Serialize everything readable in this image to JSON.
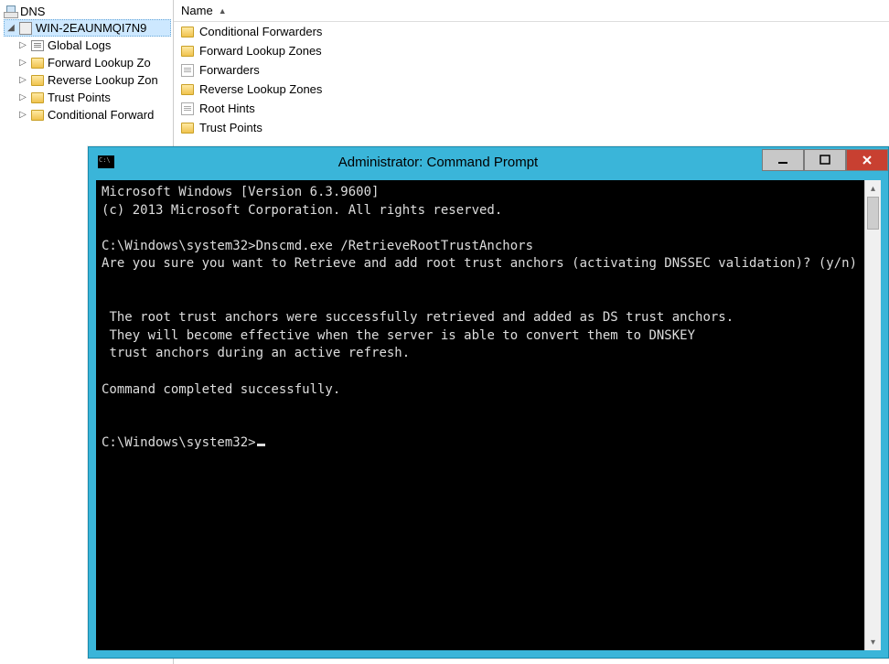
{
  "tree": {
    "root": "DNS",
    "server": "WIN-2EAUNMQI7N9",
    "children": [
      "Global Logs",
      "Forward Lookup Zo",
      "Reverse Lookup Zon",
      "Trust Points",
      "Conditional Forward"
    ]
  },
  "list": {
    "header": "Name",
    "items": [
      {
        "icon": "folder",
        "label": "Conditional Forwarders"
      },
      {
        "icon": "folder",
        "label": "Forward Lookup Zones"
      },
      {
        "icon": "doc",
        "label": "Forwarders"
      },
      {
        "icon": "folder",
        "label": "Reverse Lookup Zones"
      },
      {
        "icon": "doc",
        "label": "Root Hints"
      },
      {
        "icon": "folder",
        "label": "Trust Points"
      }
    ]
  },
  "cmd": {
    "title": "Administrator: Command Prompt",
    "lines": [
      "Microsoft Windows [Version 6.3.9600]",
      "(c) 2013 Microsoft Corporation. All rights reserved.",
      "",
      "C:\\Windows\\system32>Dnscmd.exe /RetrieveRootTrustAnchors",
      "Are you sure you want to Retrieve and add root trust anchors (activating DNSSEC validation)? (y/n) y",
      "",
      "",
      " The root trust anchors were successfully retrieved and added as DS trust anchors.",
      " They will become effective when the server is able to convert them to DNSKEY",
      " trust anchors during an active refresh.",
      "",
      "Command completed successfully.",
      "",
      "",
      "C:\\Windows\\system32>"
    ]
  }
}
